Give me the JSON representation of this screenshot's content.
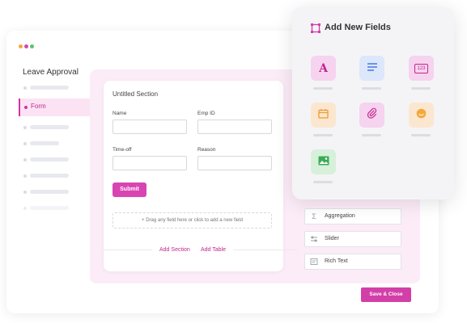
{
  "app": {
    "title": "Leave Approval"
  },
  "sidebar": {
    "active_label": "Form"
  },
  "form": {
    "section_title": "Untitled Section",
    "fields": [
      {
        "label": "Name"
      },
      {
        "label": "Emp ID"
      },
      {
        "label": "Time-off"
      },
      {
        "label": "Reason"
      }
    ],
    "submit_label": "Submit",
    "drop_hint": "+ Drag any field here or click to add a new field",
    "add_section": "Add Section",
    "add_table": "Add Table"
  },
  "field_list": [
    {
      "label": "Aggregation",
      "icon": "sigma-icon"
    },
    {
      "label": "Slider",
      "icon": "slider-icon"
    },
    {
      "label": "Rich Text",
      "icon": "rich-text-icon"
    }
  ],
  "actions": {
    "save_close": "Save & Close"
  },
  "panel": {
    "title": "Add New Fields",
    "tiles": [
      {
        "icon": "text-icon",
        "glyph": "A",
        "bg": "#f6d3ef",
        "fg": "#c2278e"
      },
      {
        "icon": "multiline-icon",
        "glyph": "",
        "bg": "#dde7fb",
        "fg": "#4d7fe6"
      },
      {
        "icon": "number-icon",
        "glyph": "123",
        "bg": "#f6d3ef",
        "fg": "#c2278e"
      },
      {
        "icon": "calendar-icon",
        "glyph": "",
        "bg": "#fbe7d0",
        "fg": "#f09a2e"
      },
      {
        "icon": "attachment-icon",
        "glyph": "",
        "bg": "#f6d3ef",
        "fg": "#c2278e"
      },
      {
        "icon": "emoji-icon",
        "glyph": "",
        "bg": "#fbe7d0",
        "fg": "#f09a2e"
      },
      {
        "icon": "image-icon",
        "glyph": "",
        "bg": "#d7f0da",
        "fg": "#3aab55"
      }
    ]
  },
  "colors": {
    "accent": "#d33fa8",
    "window_dots": [
      "#f3a93c",
      "#d845b3",
      "#5cc46a"
    ]
  }
}
